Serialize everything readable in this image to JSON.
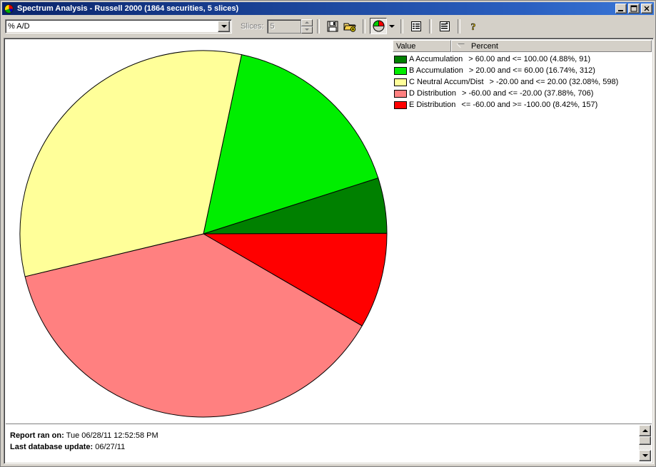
{
  "window": {
    "title": "Spectrum Analysis - Russell 2000 (1864 securities, 5 slices)",
    "icon": "pie-chart-icon",
    "minimize_label": "_",
    "maximize_label": "□",
    "close_label": "✕"
  },
  "toolbar": {
    "metric_combo": {
      "value": "% A/D",
      "arrow": "chevron-down-icon"
    },
    "slices_label": "Slices:",
    "slices_value": "5",
    "buttons": [
      {
        "name": "save-button",
        "icon": "floppy-disk-icon",
        "label": "Save"
      },
      {
        "name": "open-add-button",
        "icon": "folder-add-icon",
        "label": "Open"
      },
      {
        "name": "chart-type-button",
        "icon": "pie-chart-icon",
        "label": "Chart Type"
      },
      {
        "name": "chart-type-dropdown",
        "icon": "chevron-down-icon",
        "label": "Chart Type Options"
      },
      {
        "name": "report-view-button",
        "icon": "list-view-icon",
        "label": "Report View"
      },
      {
        "name": "add-report-button",
        "icon": "list-add-icon",
        "label": "Add Report"
      },
      {
        "name": "help-button",
        "icon": "question-mark-icon",
        "label": "Help"
      }
    ]
  },
  "legend": {
    "columns": [
      {
        "key": "value",
        "label": "Value"
      },
      {
        "key": "percent",
        "label": "Percent",
        "sort": "descending"
      }
    ],
    "rows": [
      {
        "name": "A Accumulation",
        "description": "> 60.00 and <= 100.00 (4.88%, 91)",
        "color": "#008000"
      },
      {
        "name": "B Accumulation",
        "description": "> 20.00 and <= 60.00 (16.74%, 312)",
        "color": "#00EE00"
      },
      {
        "name": "C Neutral Accum/Dist",
        "description": "> -20.00 and <= 20.00 (32.08%, 598)",
        "color": "#FFFF99"
      },
      {
        "name": "D Distribution",
        "description": "> -60.00 and <= -20.00 (37.88%, 706)",
        "color": "#FF8080"
      },
      {
        "name": "E Distribution",
        "description": "<= -60.00 and >= -100.00 (8.42%, 157)",
        "color": "#FF0000"
      }
    ]
  },
  "footer": {
    "report_ran_label": "Report ran on:",
    "report_ran_value": "Tue 06/28/11 12:52:58 PM",
    "last_update_label": "Last database update:",
    "last_update_value": "06/27/11"
  },
  "chart_data": {
    "type": "pie",
    "title": "Spectrum Analysis - Russell 2000",
    "total_securities": 1864,
    "slice_count": 5,
    "start_angle_deg": 12,
    "direction": "clockwise",
    "legend_position": "right",
    "categories": [
      "B Accumulation",
      "A Accumulation",
      "E Distribution",
      "D Distribution",
      "C Neutral Accum/Dist"
    ],
    "values": [
      16.74,
      4.88,
      8.42,
      37.88,
      32.08
    ],
    "counts": [
      312,
      91,
      157,
      706,
      598
    ],
    "colors": [
      "#00EE00",
      "#008000",
      "#FF0000",
      "#FF8080",
      "#FFFF99"
    ],
    "ranges": [
      "> 20.00 and <= 60.00",
      "> 60.00 and <= 100.00",
      "<= -60.00 and >= -100.00",
      "> -60.00 and <= -20.00",
      "> -20.00 and <= 20.00"
    ],
    "xlabel": "",
    "ylabel": ""
  }
}
